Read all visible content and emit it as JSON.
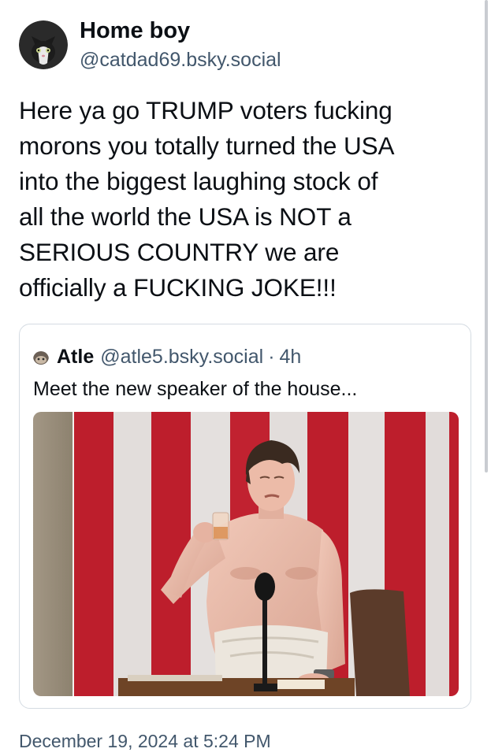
{
  "post": {
    "author": {
      "display_name": "Home boy",
      "handle": "@catdad69.bsky.social",
      "avatar_icon": "cat-avatar-icon"
    },
    "text": "Here ya go TRUMP voters fucking\nmorons you totally turned the USA\ninto the biggest laughing stock of\nall the world the USA is NOT a\nSERIOUS COUNTRY we are\nofficially a FUCKING JOKE!!!",
    "quote": {
      "author_name": "Atle",
      "author_handle": "@atle5.bsky.social",
      "separator": "·",
      "time": "4h",
      "avatar_icon": "quote-author-avatar-icon",
      "text": "Meet the new speaker of the house...",
      "image_icon": "shirtless-man-toasting-at-lectern-photo"
    },
    "timestamp": "December 19, 2024 at 5:24 PM"
  },
  "colors": {
    "text_primary": "#0b0f14",
    "text_secondary": "#42576c",
    "border": "#d4dbe2",
    "flag_red": "#c8202f",
    "background": "#ffffff"
  }
}
